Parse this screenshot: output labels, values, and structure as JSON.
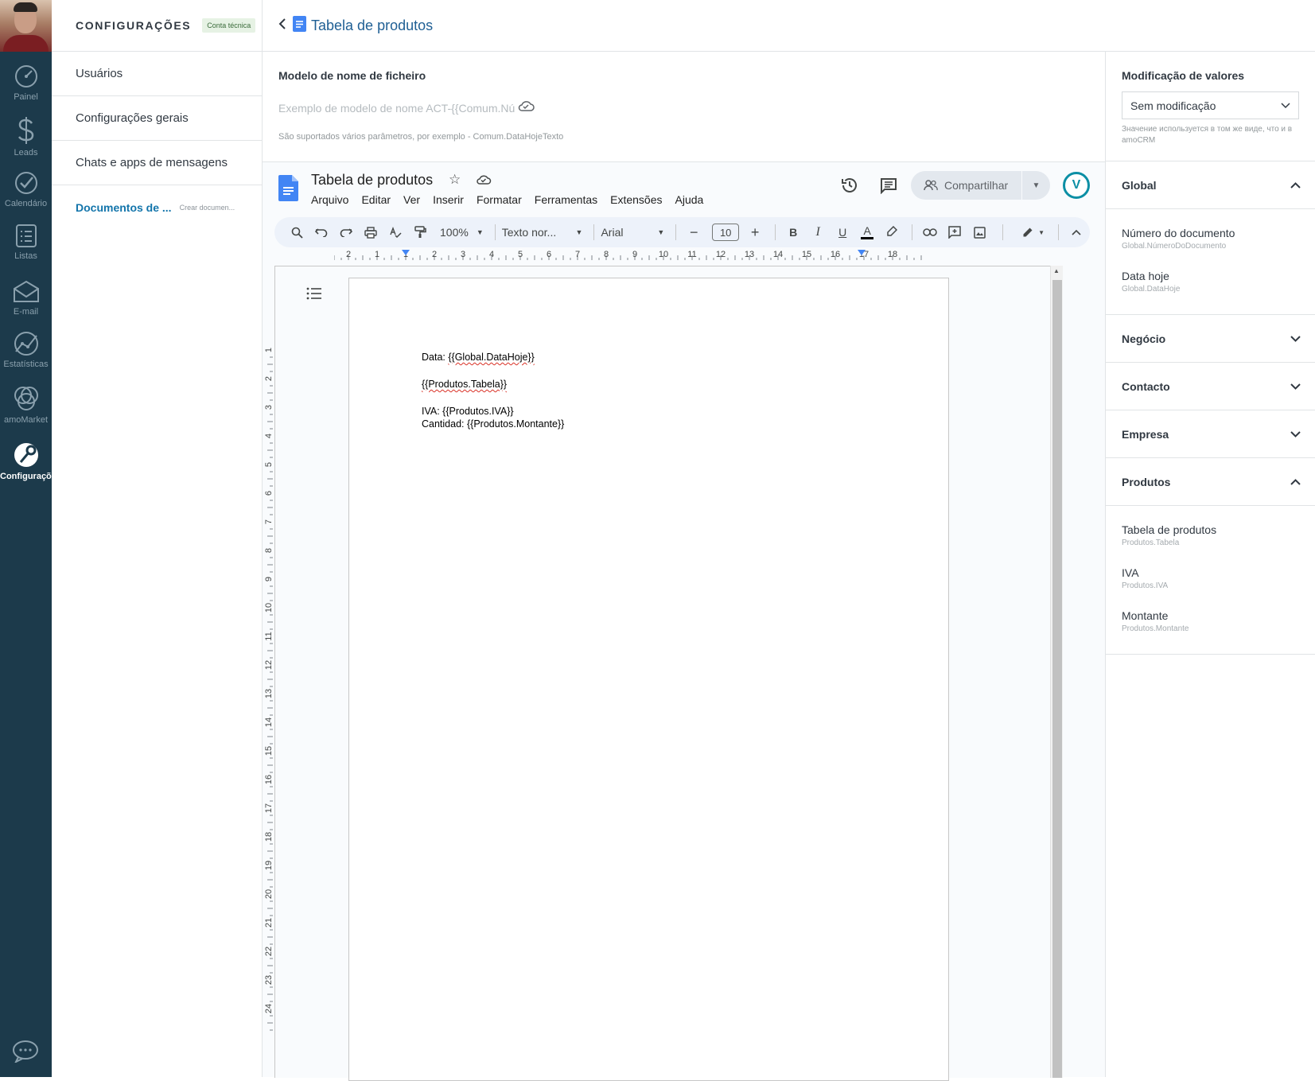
{
  "rail": {
    "items": [
      {
        "label": "Painel",
        "icon": "gauge-icon"
      },
      {
        "label": "Leads",
        "icon": "dollar-icon"
      },
      {
        "label": "Calendário",
        "icon": "check-icon"
      },
      {
        "label": "Listas",
        "icon": "list-icon"
      },
      {
        "label": "E-mail",
        "icon": "mail-icon"
      },
      {
        "label": "Estatísticas",
        "icon": "stats-icon"
      },
      {
        "label": "amoMarket",
        "icon": "market-icon"
      },
      {
        "label": "Configurações",
        "icon": "settings-icon"
      }
    ]
  },
  "settings": {
    "title": "CONFIGURAÇÕES",
    "badge": "Conta técnica",
    "items": [
      {
        "label": "Usuários"
      },
      {
        "label": "Configurações gerais"
      },
      {
        "label": "Chats e apps de mensagens"
      },
      {
        "label": "Documentos de ...",
        "sub": "Crear documen..."
      }
    ]
  },
  "header": {
    "title": "Tabela de produtos"
  },
  "filename": {
    "label": "Modelo de nome de ficheiro",
    "placeholder": "Exemplo de modelo de nome ACT-{{Comum.Nú",
    "hint": "São suportados vários parâmetros, por exemplo - Comum.DataHojeTexto"
  },
  "right_panel": {
    "mod_label": "Modificação de valores",
    "mod_value": "Sem modificação",
    "mod_hint": "Значение используется в том же виде, что и в amoCRM",
    "sections": [
      {
        "title": "Global",
        "open": true,
        "fields": [
          {
            "name": "Número do documento",
            "path": "Global.NúmeroDoDocumento"
          },
          {
            "name": "Data hoje",
            "path": "Global.DataHoje"
          }
        ]
      },
      {
        "title": "Negócio",
        "open": false,
        "fields": []
      },
      {
        "title": "Contacto",
        "open": false,
        "fields": []
      },
      {
        "title": "Empresa",
        "open": false,
        "fields": []
      },
      {
        "title": "Produtos",
        "open": true,
        "fields": [
          {
            "name": "Tabela de produtos",
            "path": "Produtos.Tabela"
          },
          {
            "name": "IVA",
            "path": "Produtos.IVA"
          },
          {
            "name": "Montante",
            "path": "Produtos.Montante"
          }
        ]
      }
    ]
  },
  "gdocs": {
    "title": "Tabela de produtos",
    "menu": [
      "Arquivo",
      "Editar",
      "Ver",
      "Inserir",
      "Formatar",
      "Ferramentas",
      "Extensões",
      "Ajuda"
    ],
    "share": "Compartilhar",
    "avatar": "V",
    "zoom": "100%",
    "style": "Texto nor...",
    "font": "Arial",
    "font_size": "10",
    "ruler_h": [
      "2",
      "1",
      "1",
      "2",
      "3",
      "4",
      "5",
      "6",
      "7",
      "8",
      "9",
      "10",
      "11",
      "12",
      "13",
      "14",
      "15",
      "16",
      "17",
      "18"
    ],
    "ruler_v": [
      "1",
      "2",
      "3",
      "4",
      "5",
      "6",
      "7",
      "8",
      "9",
      "10",
      "11",
      "12",
      "13",
      "14",
      "15",
      "16",
      "17",
      "18",
      "19",
      "20",
      "21",
      "22",
      "23",
      "24"
    ],
    "doc": {
      "l1_label": "Data: ",
      "l1_var": "{{Global.DataHoje}}",
      "l2_var": "{{Produtos.Tabela}}",
      "l3_label": "IVA: ",
      "l3_var": "{{Produtos.IVA}}",
      "l4": "Cantidad: {{Produtos.Montante}}"
    }
  }
}
